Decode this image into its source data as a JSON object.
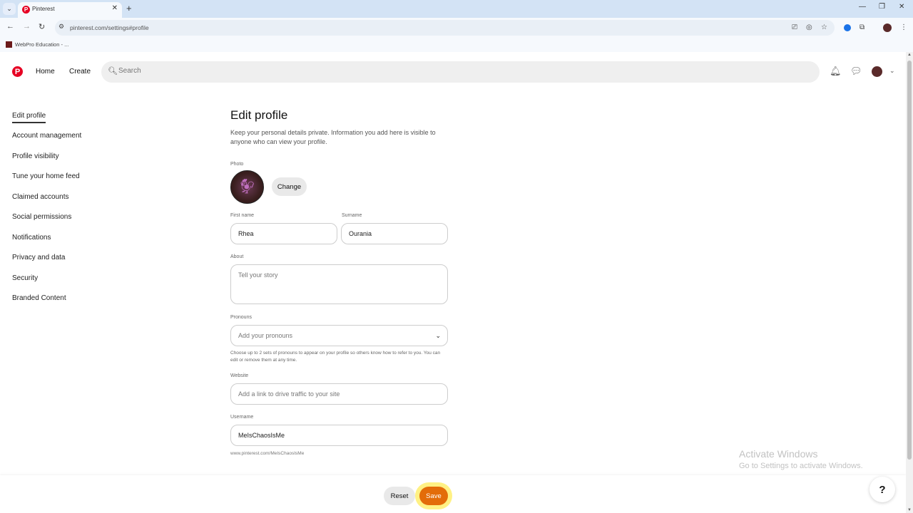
{
  "browser": {
    "tab_title": "Pinterest",
    "url": "pinterest.com/settings#profile",
    "bookmark": "WebPro Education - ..."
  },
  "header": {
    "home": "Home",
    "create": "Create",
    "search_placeholder": "Search"
  },
  "sidebar": {
    "items": [
      {
        "label": "Edit profile",
        "active": true
      },
      {
        "label": "Account management"
      },
      {
        "label": "Profile visibility"
      },
      {
        "label": "Tune your home feed"
      },
      {
        "label": "Claimed accounts"
      },
      {
        "label": "Social permissions"
      },
      {
        "label": "Notifications"
      },
      {
        "label": "Privacy and data"
      },
      {
        "label": "Security"
      },
      {
        "label": "Branded Content"
      }
    ]
  },
  "form": {
    "title": "Edit profile",
    "subtitle": "Keep your personal details private. Information you add here is visible to anyone who can view your profile.",
    "photo_label": "Photo",
    "change_label": "Change",
    "first_name_label": "First name",
    "first_name": "Rhea",
    "surname_label": "Surname",
    "surname": "Ourania",
    "about_label": "About",
    "about_placeholder": "Tell your story",
    "pronouns_label": "Pronouns",
    "pronouns_placeholder": "Add your pronouns",
    "pronouns_help": "Choose up to 2 sets of pronouns to appear on your profile so others know how to refer to you. You can edit or remove them at any time.",
    "website_label": "Website",
    "website_placeholder": "Add a link to drive traffic to your site",
    "username_label": "Username",
    "username": "MeIsChaosIsMe",
    "username_url": "www.pinterest.com/MeIsChaosIsMe"
  },
  "footer": {
    "reset": "Reset",
    "save": "Save",
    "help": "?"
  },
  "watermark": {
    "line1": "Activate Windows",
    "line2": "Go to Settings to activate Windows."
  },
  "colors": {
    "brand": "#e60023",
    "save": "#e36c09"
  }
}
